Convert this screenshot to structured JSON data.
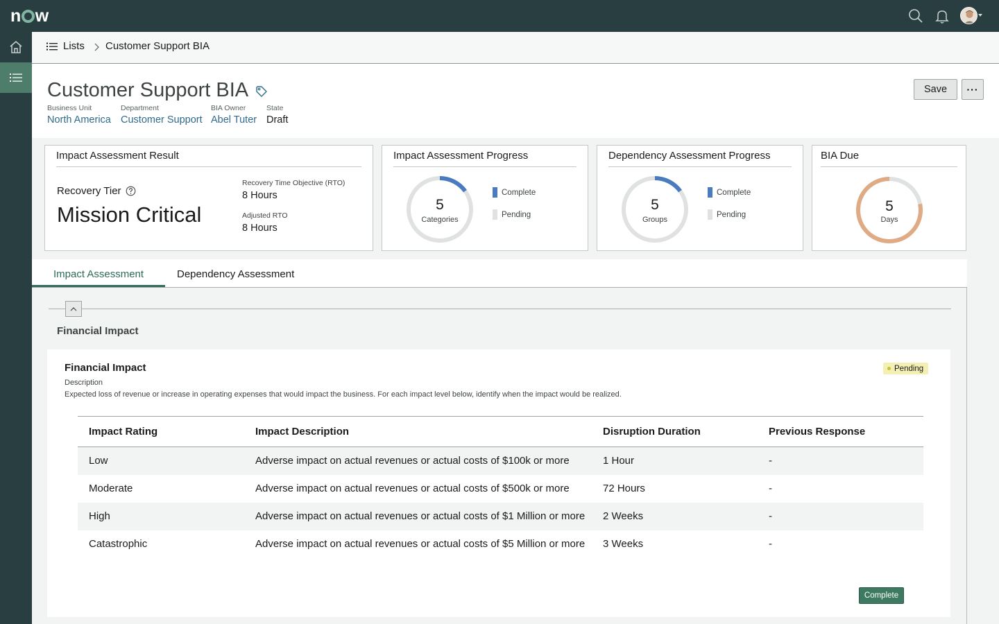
{
  "header": {
    "logo_text": "now",
    "icons": [
      "search-icon",
      "bell-icon",
      "avatar",
      "chevron-down-icon"
    ]
  },
  "rail": {
    "items": [
      {
        "name": "home-icon",
        "active": false
      },
      {
        "name": "list-icon",
        "active": true
      }
    ]
  },
  "breadcrumb": {
    "lists_label": "Lists",
    "current": "Customer Support BIA"
  },
  "record": {
    "title": "Customer Support BIA",
    "fields": [
      {
        "label": "Business Unit",
        "value": "North America",
        "link": true
      },
      {
        "label": "Department",
        "value": "Customer Support",
        "link": true
      },
      {
        "label": "BIA Owner",
        "value": "Abel Tuter",
        "link": true
      },
      {
        "label": "State",
        "value": "Draft",
        "link": false
      }
    ],
    "save_label": "Save",
    "more_label": "···"
  },
  "cards": {
    "impact_result": {
      "title": "Impact Assessment Result",
      "tier_label": "Recovery Tier",
      "tier_value": "Mission Critical",
      "rto_label": "Recovery Time Objective (RTO)",
      "rto_value": "8 Hours",
      "adjusted_label": "Adjusted RTO",
      "adjusted_value": "8 Hours"
    },
    "impact_progress": {
      "title": "Impact Assessment Progress",
      "count": "5",
      "unit": "Categories",
      "complete_fraction": 0.15,
      "legend_complete": "Complete",
      "legend_pending": "Pending"
    },
    "dependency_progress": {
      "title": "Dependency Assessment Progress",
      "count": "5",
      "unit": "Groups",
      "complete_fraction": 0.15,
      "legend_complete": "Complete",
      "legend_pending": "Pending"
    },
    "bia_due": {
      "title": "BIA Due",
      "count": "5",
      "unit": "Days",
      "fraction": 0.78
    }
  },
  "colors": {
    "complete": "#4a7bbf",
    "pending": "#e0e2e2",
    "due": "#dfab84",
    "accent": "#2e6b5a"
  },
  "tabs": [
    {
      "label": "Impact Assessment",
      "active": true
    },
    {
      "label": "Dependency Assessment",
      "active": false
    }
  ],
  "section": {
    "heading": "Financial Impact",
    "card_title": "Financial Impact",
    "status": "Pending",
    "description_label": "Description",
    "description": "Expected loss of revenue or increase in operating expenses that would impact the business. For each impact level below, identify when the impact would be realized.",
    "table": {
      "headers": [
        "Impact Rating",
        "Impact Description",
        "Disruption Duration",
        "Previous Response"
      ],
      "rows": [
        [
          "Low",
          "Adverse impact on actual revenues or actual costs of $100k or more",
          "1 Hour",
          "-"
        ],
        [
          "Moderate",
          "Adverse impact on actual revenues or actual costs of $500k or more",
          "72 Hours",
          "-"
        ],
        [
          "High",
          "Adverse impact on actual revenues or actual costs of $1 Million or more",
          "2 Weeks",
          "-"
        ],
        [
          "Catastrophic",
          "Adverse impact on actual revenues or actual costs of $5 Million or more",
          "3 Weeks",
          "-"
        ]
      ]
    },
    "complete_label": "Complete"
  }
}
